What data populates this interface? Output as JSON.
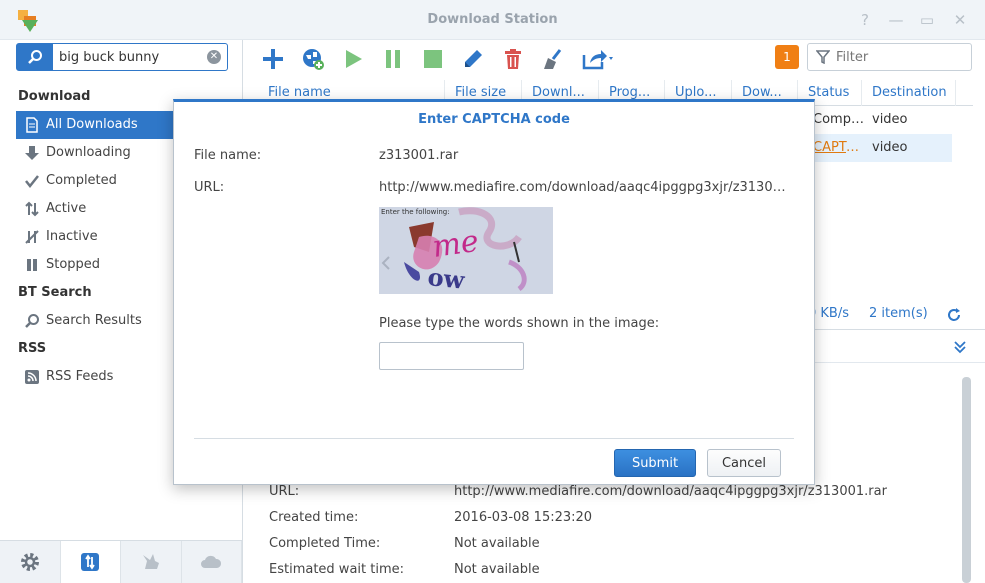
{
  "window": {
    "title": "Download Station",
    "controls": {
      "help": "?",
      "minimize": "—",
      "maximize": "▭",
      "close": "✕"
    }
  },
  "sidebar": {
    "search_value": "big buck bunny",
    "sections": {
      "download": "Download",
      "bt_search": "BT Search",
      "rss": "RSS"
    },
    "items": {
      "all_downloads": "All Downloads",
      "downloading": "Downloading",
      "completed": "Completed",
      "active": "Active",
      "inactive": "Inactive",
      "stopped": "Stopped",
      "search_results": "Search Results",
      "rss_feeds": "RSS Feeds"
    },
    "active_item": "all_downloads"
  },
  "toolbar": {
    "notification_count": "1",
    "filter_placeholder": "Filter",
    "colors": {
      "blue": "#2f77c8",
      "green": "#5cb85c",
      "red": "#d9534f",
      "badge": "#f07f14"
    }
  },
  "table": {
    "columns": {
      "file_name": "File name",
      "file_size": "File size",
      "downloaded": "Downl...",
      "progress": "Prog...",
      "uploaded": "Uplo...",
      "download_speed": "Dow...",
      "status": "Status",
      "destination": "Destination"
    },
    "rows": [
      {
        "status": "Comple...",
        "destination": "video"
      },
      {
        "status": "CAPTCH...",
        "destination": "video"
      }
    ]
  },
  "statusbar": {
    "speed": "0 KB/s",
    "items": "2 item(s)"
  },
  "details": {
    "rows": [
      {
        "label": "URL:",
        "value": "http://www.mediafire.com/download/aaqc4ipggpg3xjr/z313001.rar"
      },
      {
        "label": "Created time:",
        "value": "2016-03-08 15:23:20"
      },
      {
        "label": "Completed Time:",
        "value": "Not available"
      },
      {
        "label": "Estimated wait time:",
        "value": "Not available"
      }
    ]
  },
  "dialog": {
    "title": "Enter CAPTCHA code",
    "file_name_label": "File name:",
    "file_name_value": "z313001.rar",
    "url_label": "URL:",
    "url_value": "http://www.mediafire.com/download/aaqc4ipggpg3xjr/z313001....",
    "captcha_caption": "Enter the following:",
    "prompt": "Please type the words shown in the image:",
    "submit_label": "Submit",
    "cancel_label": "Cancel"
  }
}
